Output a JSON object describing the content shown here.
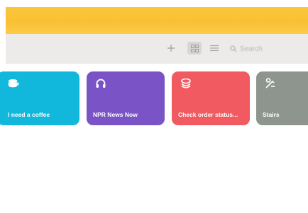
{
  "toolbar": {
    "add_icon": "plus-icon",
    "grid_icon": "grid-view-icon",
    "list_icon": "list-view-icon",
    "search_icon": "magnifier-icon",
    "search_placeholder": "Search"
  },
  "shortcuts": [
    {
      "label": "I need a coffee",
      "icon": "coffee-cup-icon",
      "color": "#12b8db"
    },
    {
      "label": "NPR News Now",
      "icon": "headphones-icon",
      "color": "#7a54c6"
    },
    {
      "label": "Check order status...",
      "icon": "layers-icon",
      "color": "#f05a60"
    },
    {
      "label": "Stairs",
      "icon": "stairs-icon",
      "color": "#8e958e"
    }
  ],
  "colors": {
    "banner": "#fac033",
    "toolbar_bg": "#ecebea"
  }
}
